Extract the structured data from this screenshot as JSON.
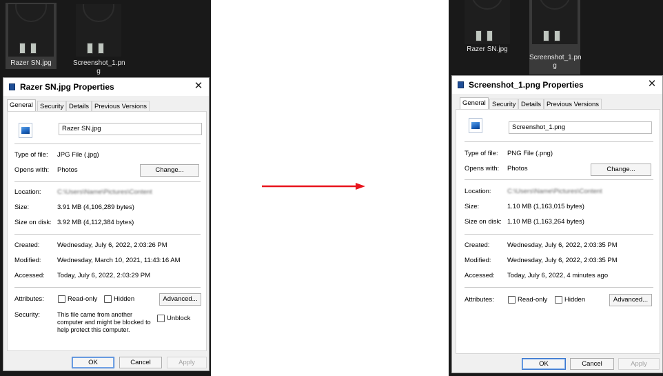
{
  "left": {
    "thumbnails": [
      {
        "label_line1": "Razer SN.jpg",
        "label_line2": ""
      },
      {
        "label_line1": "Screenshot_1.pn",
        "label_line2": "g"
      }
    ],
    "dialog": {
      "title": "Razer SN.jpg Properties",
      "tabs": [
        "General",
        "Security",
        "Details",
        "Previous Versions"
      ],
      "file_name": "Razer SN.jpg",
      "type_label": "Type of file:",
      "type_value": "JPG File (.jpg)",
      "opens_label": "Opens with:",
      "opens_value": "Photos",
      "change_label": "Change...",
      "location_label": "Location:",
      "location_value": "C:\\Users\\Name\\Pictures\\Content",
      "size_label": "Size:",
      "size_value": "3.91 MB (4,106,289 bytes)",
      "disk_label": "Size on disk:",
      "disk_value": "3.92 MB (4,112,384 bytes)",
      "created_label": "Created:",
      "created_value": "Wednesday, July 6, 2022, 2:03:26 PM",
      "modified_label": "Modified:",
      "modified_value": "Wednesday, March 10, 2021, 11:43:16 AM",
      "accessed_label": "Accessed:",
      "accessed_value": "Today, July 6, 2022, 2:03:29 PM",
      "attributes_label": "Attributes:",
      "readonly_label": "Read-only",
      "hidden_label": "Hidden",
      "advanced_label": "Advanced...",
      "security_label": "Security:",
      "security_text": "This file came from another computer and might be blocked to help protect this computer.",
      "unblock_label": "Unblock",
      "ok_label": "OK",
      "cancel_label": "Cancel",
      "apply_label": "Apply"
    }
  },
  "right": {
    "thumbnails": [
      {
        "label_line1": "Razer SN.jpg",
        "label_line2": ""
      },
      {
        "label_line1": "Screenshot_1.pn",
        "label_line2": "g"
      }
    ],
    "dialog": {
      "title": "Screenshot_1.png Properties",
      "tabs": [
        "General",
        "Security",
        "Details",
        "Previous Versions"
      ],
      "file_name": "Screenshot_1.png",
      "type_label": "Type of file:",
      "type_value": "PNG File (.png)",
      "opens_label": "Opens with:",
      "opens_value": "Photos",
      "change_label": "Change...",
      "location_label": "Location:",
      "location_value": "C:\\Users\\Name\\Pictures\\Content",
      "size_label": "Size:",
      "size_value": "1.10 MB (1,163,015 bytes)",
      "disk_label": "Size on disk:",
      "disk_value": "1.10 MB (1,163,264 bytes)",
      "created_label": "Created:",
      "created_value": "Wednesday, July 6, 2022, 2:03:35 PM",
      "modified_label": "Modified:",
      "modified_value": "Wednesday, July 6, 2022, 2:03:35 PM",
      "accessed_label": "Accessed:",
      "accessed_value": "Today, July 6, 2022, 4 minutes ago",
      "attributes_label": "Attributes:",
      "readonly_label": "Read-only",
      "hidden_label": "Hidden",
      "advanced_label": "Advanced...",
      "ok_label": "OK",
      "cancel_label": "Cancel",
      "apply_label": "Apply"
    }
  },
  "colors": {
    "arrow": "#e8141c",
    "explorer_bg": "#191919",
    "dialog_bg": "#f0f0f0"
  },
  "icons": [
    "window-icon",
    "close-icon",
    "image-file-icon",
    "arrow-right-icon"
  ]
}
